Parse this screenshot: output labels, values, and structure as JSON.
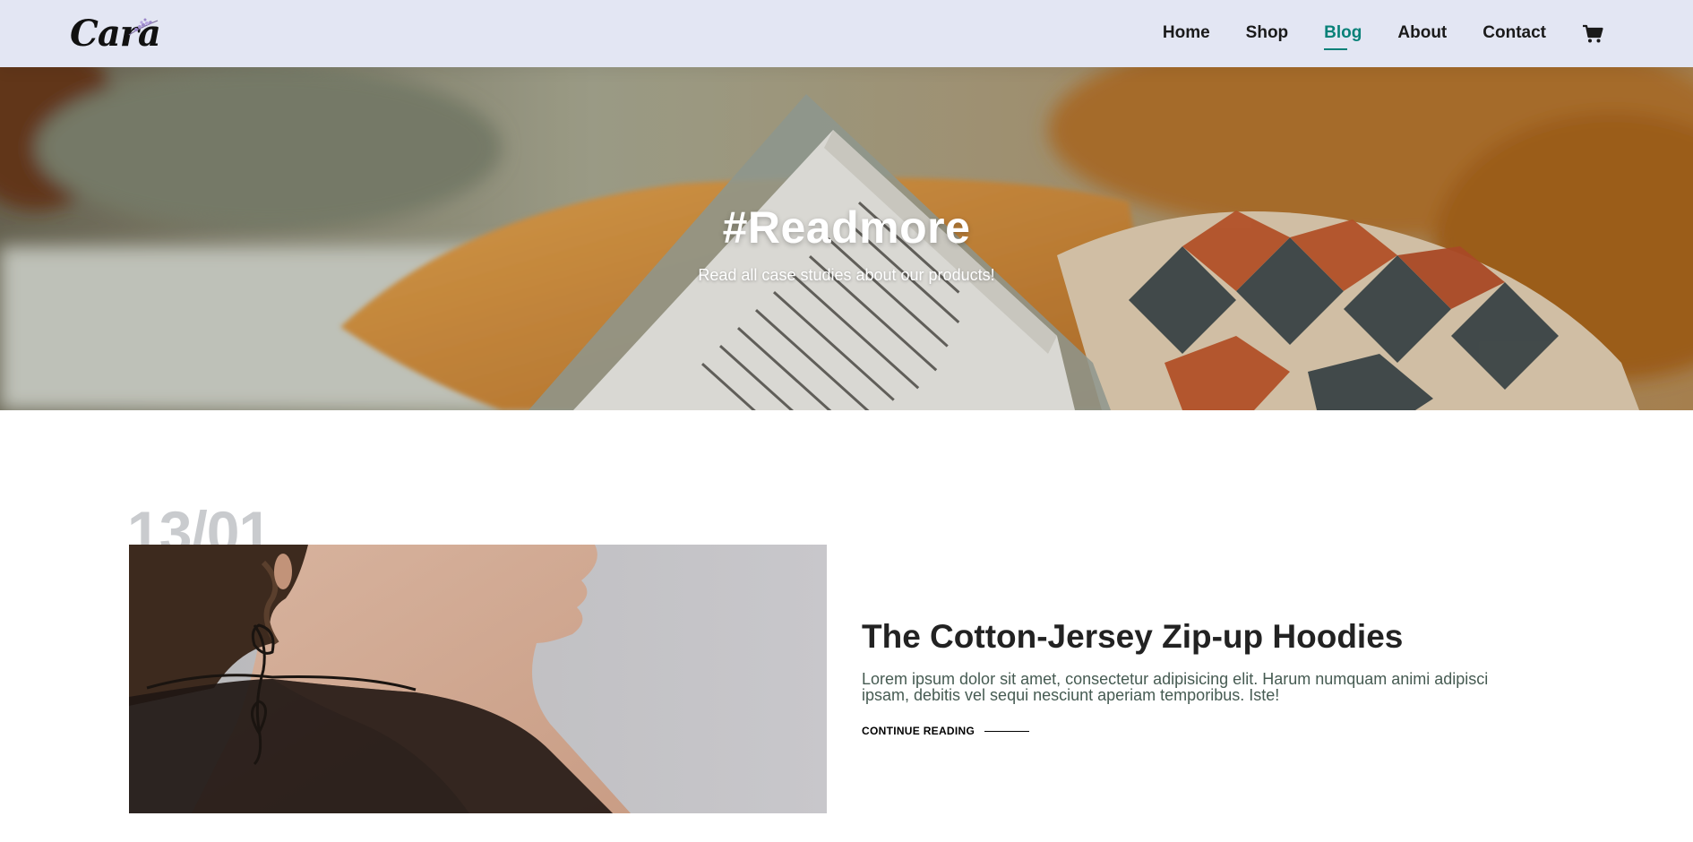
{
  "header": {
    "logo_text": "Cara",
    "nav": [
      {
        "label": "Home"
      },
      {
        "label": "Shop"
      },
      {
        "label": "Blog",
        "active": true
      },
      {
        "label": "About"
      },
      {
        "label": "Contact"
      }
    ],
    "cart_icon": "cart-icon"
  },
  "hero": {
    "title": "#Readmore",
    "subtitle": "Read all case studies about our products!"
  },
  "post": {
    "date": "13/01",
    "title": "The Cotton-Jersey Zip-up Hoodies",
    "excerpt": "Lorem ipsum dolor sit amet, consectetur adipisicing elit. Harum numquam animi adipisci ipsam, debitis vel sequi nesciunt aperiam temporibus. Iste!",
    "cta": "CONTINUE READING"
  },
  "colors": {
    "header_bg": "#e3e6f3",
    "accent": "#088178",
    "date_watermark": "#c9cbce"
  }
}
